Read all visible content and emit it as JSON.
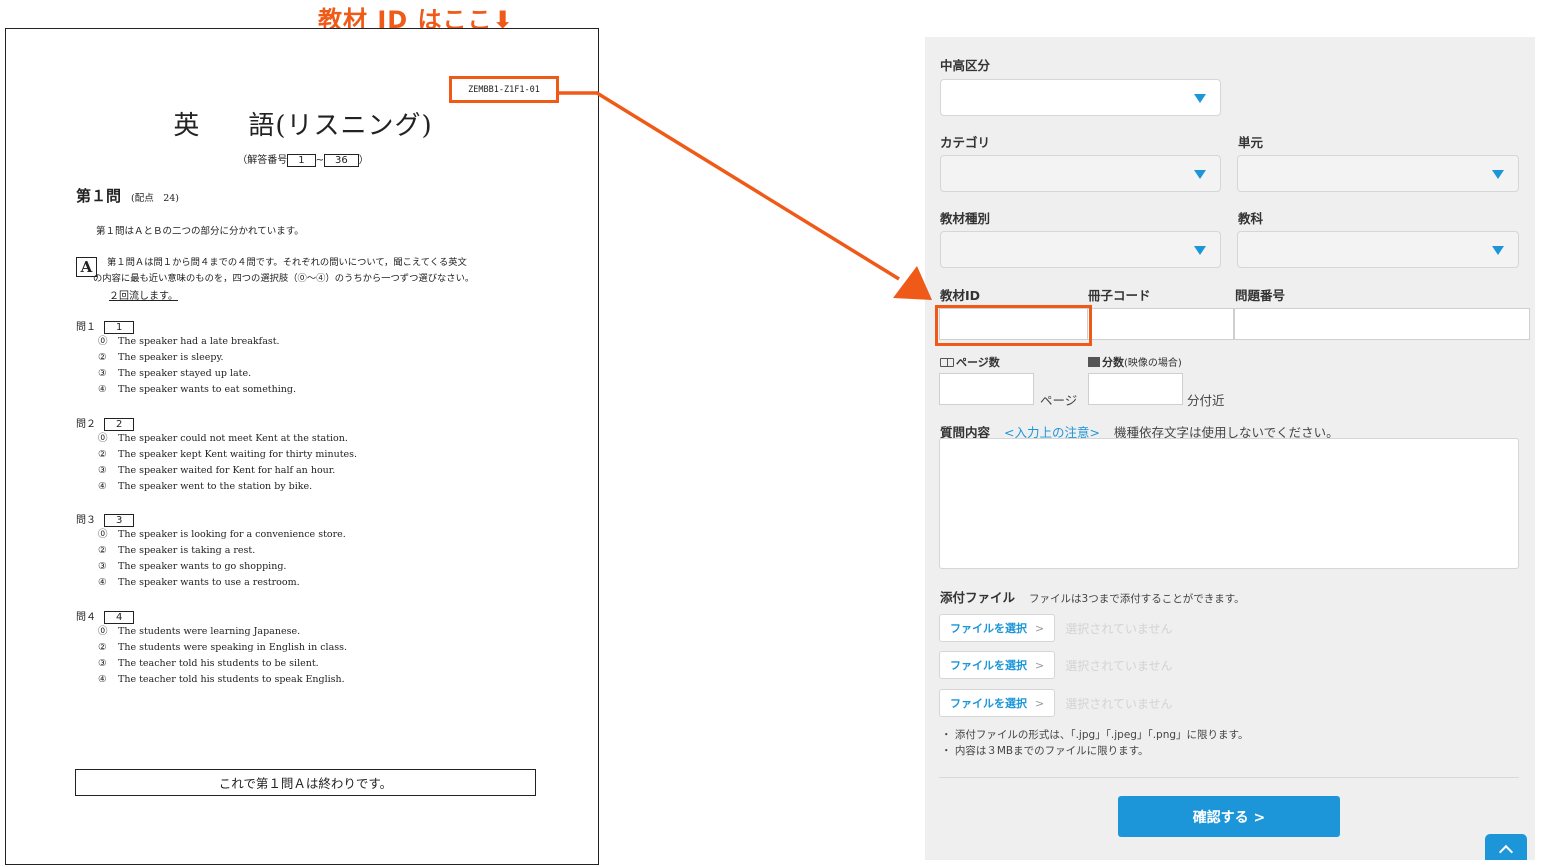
{
  "annotation": {
    "title": "教材 ID はここ",
    "arrow_glyph": "⬇",
    "accent_color": "#f05a19"
  },
  "document": {
    "material_id": "ZEMBB1-Z1F1-01",
    "title_left": "英",
    "title_right": "語(リスニング)",
    "answer_numbers_prefix": "（解答番号",
    "answer_from": "1",
    "answer_sep": "~",
    "answer_to": "36",
    "answer_suffix": "）",
    "q1_heading": "第１問",
    "q1_points": "(配点　24)",
    "intro": "第１問はＡとＢの二つの部分に分かれています。",
    "section_a_label": "A",
    "section_a_line1": "第１問Ａは問１から問４までの４問です。それぞれの問いについて，聞こえてくる英文",
    "section_a_line2": "の内容に最も近い意味のものを，四つの選択肢（⓪～④）のうちから一つずつ選びなさい。",
    "repeat_note": "２回流します。",
    "questions": [
      {
        "label": "問１",
        "box": "1",
        "options": [
          {
            "num": "⓪",
            "text": "The speaker had a late breakfast."
          },
          {
            "num": "②",
            "text": "The speaker is sleepy."
          },
          {
            "num": "③",
            "text": "The speaker stayed up late."
          },
          {
            "num": "④",
            "text": "The speaker wants to eat something."
          }
        ]
      },
      {
        "label": "問２",
        "box": "2",
        "options": [
          {
            "num": "⓪",
            "text": "The speaker could not meet Kent at the station."
          },
          {
            "num": "②",
            "text": "The speaker kept Kent waiting for thirty minutes."
          },
          {
            "num": "③",
            "text": "The speaker waited for Kent for half an hour."
          },
          {
            "num": "④",
            "text": "The speaker went to the station by bike."
          }
        ]
      },
      {
        "label": "問３",
        "box": "3",
        "options": [
          {
            "num": "⓪",
            "text": "The speaker is looking for a convenience store."
          },
          {
            "num": "②",
            "text": "The speaker is taking a rest."
          },
          {
            "num": "③",
            "text": "The speaker wants to go shopping."
          },
          {
            "num": "④",
            "text": "The speaker wants to use a restroom."
          }
        ]
      },
      {
        "label": "問４",
        "box": "4",
        "options": [
          {
            "num": "⓪",
            "text": "The students were learning Japanese."
          },
          {
            "num": "②",
            "text": "The students were speaking in English in class."
          },
          {
            "num": "③",
            "text": "The teacher told his students to be silent."
          },
          {
            "num": "④",
            "text": "The teacher told his students to speak English."
          }
        ]
      }
    ],
    "end_text": "これで第１問Ａは終わりです。"
  },
  "form": {
    "labels": {
      "school_level": "中高区分",
      "category": "カテゴリ",
      "unit": "単元",
      "material_type": "教材種別",
      "subject": "教科",
      "material_id": "教材ID",
      "booklet_code": "冊子コード",
      "question_number": "問題番号",
      "page_count": "ページ数",
      "minutes": "分数",
      "minutes_sub": "(映像の場合)",
      "page_unit": "ページ",
      "minute_unit": "分付近",
      "question_content": "質問内容",
      "input_note_link": "<入力上の注意>",
      "input_note_text": "機種依存文字は使用しないでください。",
      "attachments": "添付ファイル",
      "attachments_note": "ファイルは3つまで添付することができます。"
    },
    "file_inputs": [
      {
        "button": "ファイルを選択",
        "status": "選択されていません"
      },
      {
        "button": "ファイルを選択",
        "status": "選択されていません"
      },
      {
        "button": "ファイルを選択",
        "status": "選択されていません"
      }
    ],
    "footnotes": [
      "・ 添付ファイルの形式は、「.jpg」「.jpeg」「.png」に限ります。",
      "・ 内容は３MBまでのファイルに限ります。"
    ],
    "confirm_button": "確認する >",
    "accent_color": "#1c96d8"
  }
}
